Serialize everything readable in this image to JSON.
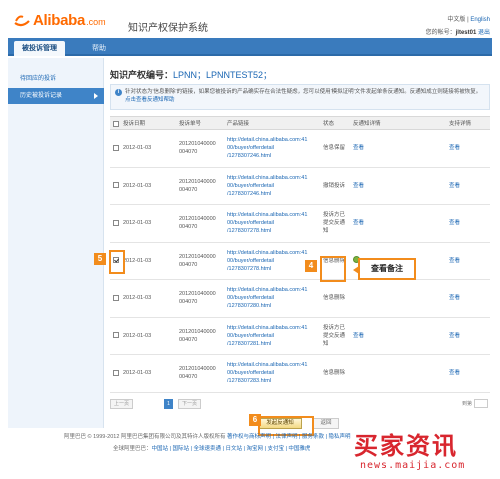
{
  "header": {
    "brand_text": "Alibaba",
    "brand_suffix": ".com",
    "site_title": "知识产权保护系统",
    "lang_cn": "中文版",
    "lang_sep": "|",
    "lang_en": "English",
    "account_prefix": "您的帐号：",
    "account_name": "jltest01",
    "logout": "退出",
    "brand_color": "#ff6a00"
  },
  "nav": {
    "tabs": [
      {
        "label": "被投诉管理",
        "active": true
      },
      {
        "label": "帮助",
        "active": false
      }
    ]
  },
  "sidebar": {
    "items": [
      {
        "label": "待回应的投诉"
      },
      {
        "label": "历史被投诉记录",
        "selected": true
      }
    ]
  },
  "main": {
    "ip_label": "知识产权编号：",
    "ip_value": "LPNN；LPNNTEST52；",
    "notice": {
      "text": "针对状态为'信息删除'的链接，如果您被投诉的产品确实存在合法性疑虑，您可以使用'模拟证明'文件发起单条反通知。反通知成立则链接将被恢复。",
      "link": "点击查看反通知帮助"
    },
    "columns": [
      "投诉日期",
      "投诉单号",
      "产品链接",
      "状态",
      "反通知详情",
      "支持详情"
    ],
    "rows": [
      {
        "checkbox": false,
        "date": "2012-01-03",
        "id": "201201040000\n004070",
        "link": "http://detail.china.alibaba.com:41\n00/buyer/offerdetail\n/127830724​6.html",
        "status": "信息保留",
        "counter": "查看",
        "support": "查看"
      },
      {
        "checkbox": false,
        "date": "2012-01-03",
        "id": "201201040000\n004070",
        "link": "http://detail.china.alibaba.com:41\n00/buyer/offerdetail\n/1278307246.html",
        "status": "撤销投诉",
        "counter": "查看",
        "support": "查看"
      },
      {
        "checkbox": false,
        "date": "2012-01-03",
        "id": "201201040000\n004070",
        "link": "http://detail.china.alibaba.com:41\n00/buyer/offerdetail\n/1278307278.html",
        "status": "投诉方已\n提交反通\n知",
        "counter": "查看",
        "support": "查看"
      },
      {
        "checkbox": true,
        "date": "2012-01-03",
        "id": "201201040000\n004070",
        "link": "http://detail.china.alibaba.com:41\n00/buyer/offerdetail\n/1278307278.html",
        "status": "信息删除",
        "counter": "",
        "support": "查看"
      },
      {
        "checkbox": false,
        "date": "2012-01-03",
        "id": "201201040000\n004070",
        "link": "http://detail.china.alibaba.com:41\n00/buyer/offerdetail\n/1278307280.html",
        "status": "信息删除",
        "counter": "",
        "support": "查看"
      },
      {
        "checkbox": false,
        "date": "2012-01-03",
        "id": "201201040000\n004070",
        "link": "http://detail.china.alibaba.com:41\n00/buyer/offerdetail\n/1278307281.html",
        "status": "投诉方已\n提交反通\n知",
        "counter": "查看",
        "support": "查看"
      },
      {
        "checkbox": false,
        "date": "2012-01-03",
        "id": "201201040000\n004070",
        "link": "http://detail.china.alibaba.com:41\n00/buyer/offerdetail\n/1278307283.html",
        "status": "信息删除",
        "counter": "",
        "support": "查看"
      }
    ],
    "pager": {
      "prev": "上一页",
      "page": "1",
      "next": "下一页",
      "goto": "到第"
    },
    "actions": {
      "primary": "发起反通知",
      "secondary": "返回"
    },
    "callout": "查看备注",
    "badges": [
      "4",
      "5",
      "6"
    ]
  },
  "footer": {
    "line1": "阿里巴巴 © 1999-2012 阿里巴巴集团有限公司及其特许人版权所有",
    "line1_links": "著作权与商标声明 | 法律声明 | 服务条款 | 隐私声明",
    "line2_prefix": "全球阿里巴巴：",
    "line2_links": "中国站 | 国际站 | 全球速卖通 | 日文站 | 淘宝网 | 支付宝 | 中国雅虎"
  },
  "watermark": {
    "cn": "买家资讯",
    "url": "news.maijia.com",
    "color": "#d8262e"
  }
}
